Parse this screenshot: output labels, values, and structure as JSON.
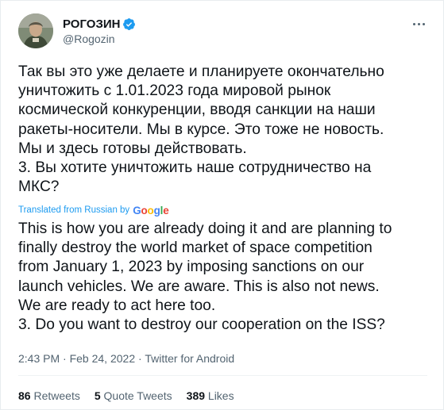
{
  "author": {
    "display_name": "РОГОЗИН",
    "handle": "@Rogozin",
    "verified": true,
    "avatar_icon": "user-avatar"
  },
  "tweet": {
    "original_text": "Так вы это уже делаете и планируете окончательно\nуничтожить с 1.01.2023 года мировой рынок\nкосмической конкуренции, вводя санкции на наши\nракеты-носители. Мы в курсе. Это тоже не новость.\nМы и здесь готовы действовать.\n3. Вы хотите уничтожить наше сотрудничество на\nМКС?",
    "translated_label": "Translated from Russian by",
    "translation_provider": "Google",
    "translated_text": "This is how you are already doing it and are planning to\nfinally destroy the world market of space competition\nfrom January 1, 2023 by imposing sanctions on our\nlaunch vehicles. We are aware. This is also not news.\nWe are ready to act here too.\n 3. Do you want to destroy our cooperation on the ISS?",
    "time": "2:43 PM",
    "date": "Feb 24, 2022",
    "source": "Twitter for Android"
  },
  "stats": {
    "retweets_count": "86",
    "retweets_label": "Retweets",
    "quotes_count": "5",
    "quotes_label": "Quote Tweets",
    "likes_count": "389",
    "likes_label": "Likes"
  },
  "colors": {
    "accent": "#1d9bf0",
    "text": "#0f1419",
    "muted": "#536471"
  }
}
